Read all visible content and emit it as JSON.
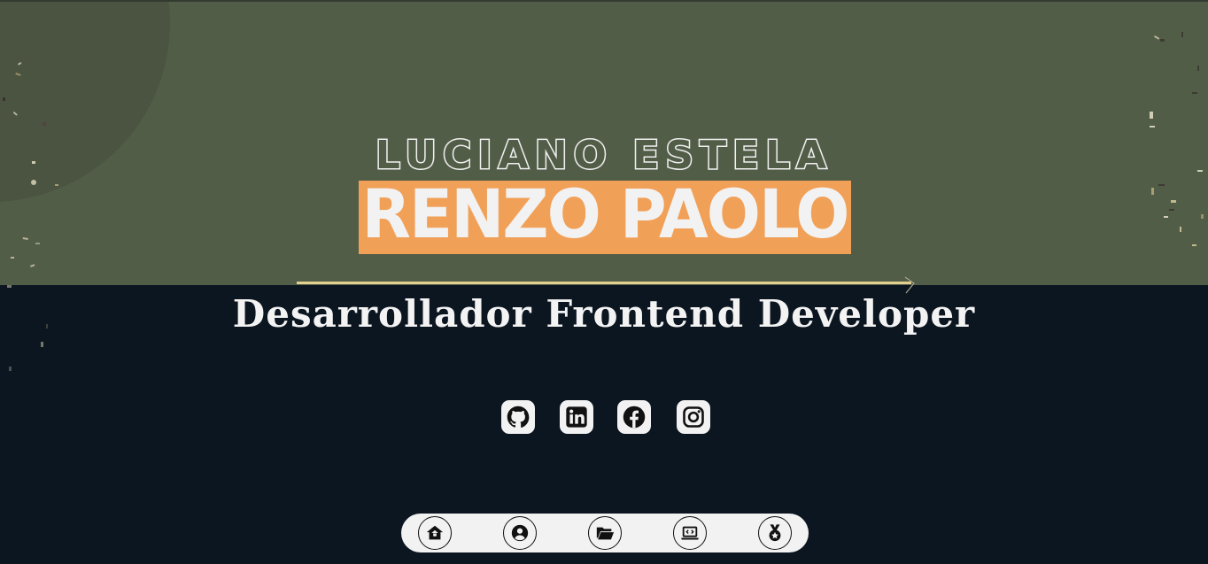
{
  "hero": {
    "first_name": "LUCIANO ESTELA",
    "last_name": "RENZO PAOLO",
    "tagline": "Desarrollador Frontend Developer"
  },
  "social_links": [
    {
      "icon": "github-icon"
    },
    {
      "icon": "linkedin-icon"
    },
    {
      "icon": "facebook-icon"
    },
    {
      "icon": "instagram-icon"
    }
  ],
  "bottom_nav": [
    {
      "icon": "home-icon"
    },
    {
      "icon": "user-icon"
    },
    {
      "icon": "folder-icon"
    },
    {
      "icon": "laptop-code-icon"
    },
    {
      "icon": "medal-icon"
    }
  ],
  "colors": {
    "hero_background": "#525d48",
    "page_background": "#0c1621",
    "accent_orange": "#f1a058",
    "divider_gold": "#e2cf90",
    "text_light": "#f2f2f2"
  }
}
